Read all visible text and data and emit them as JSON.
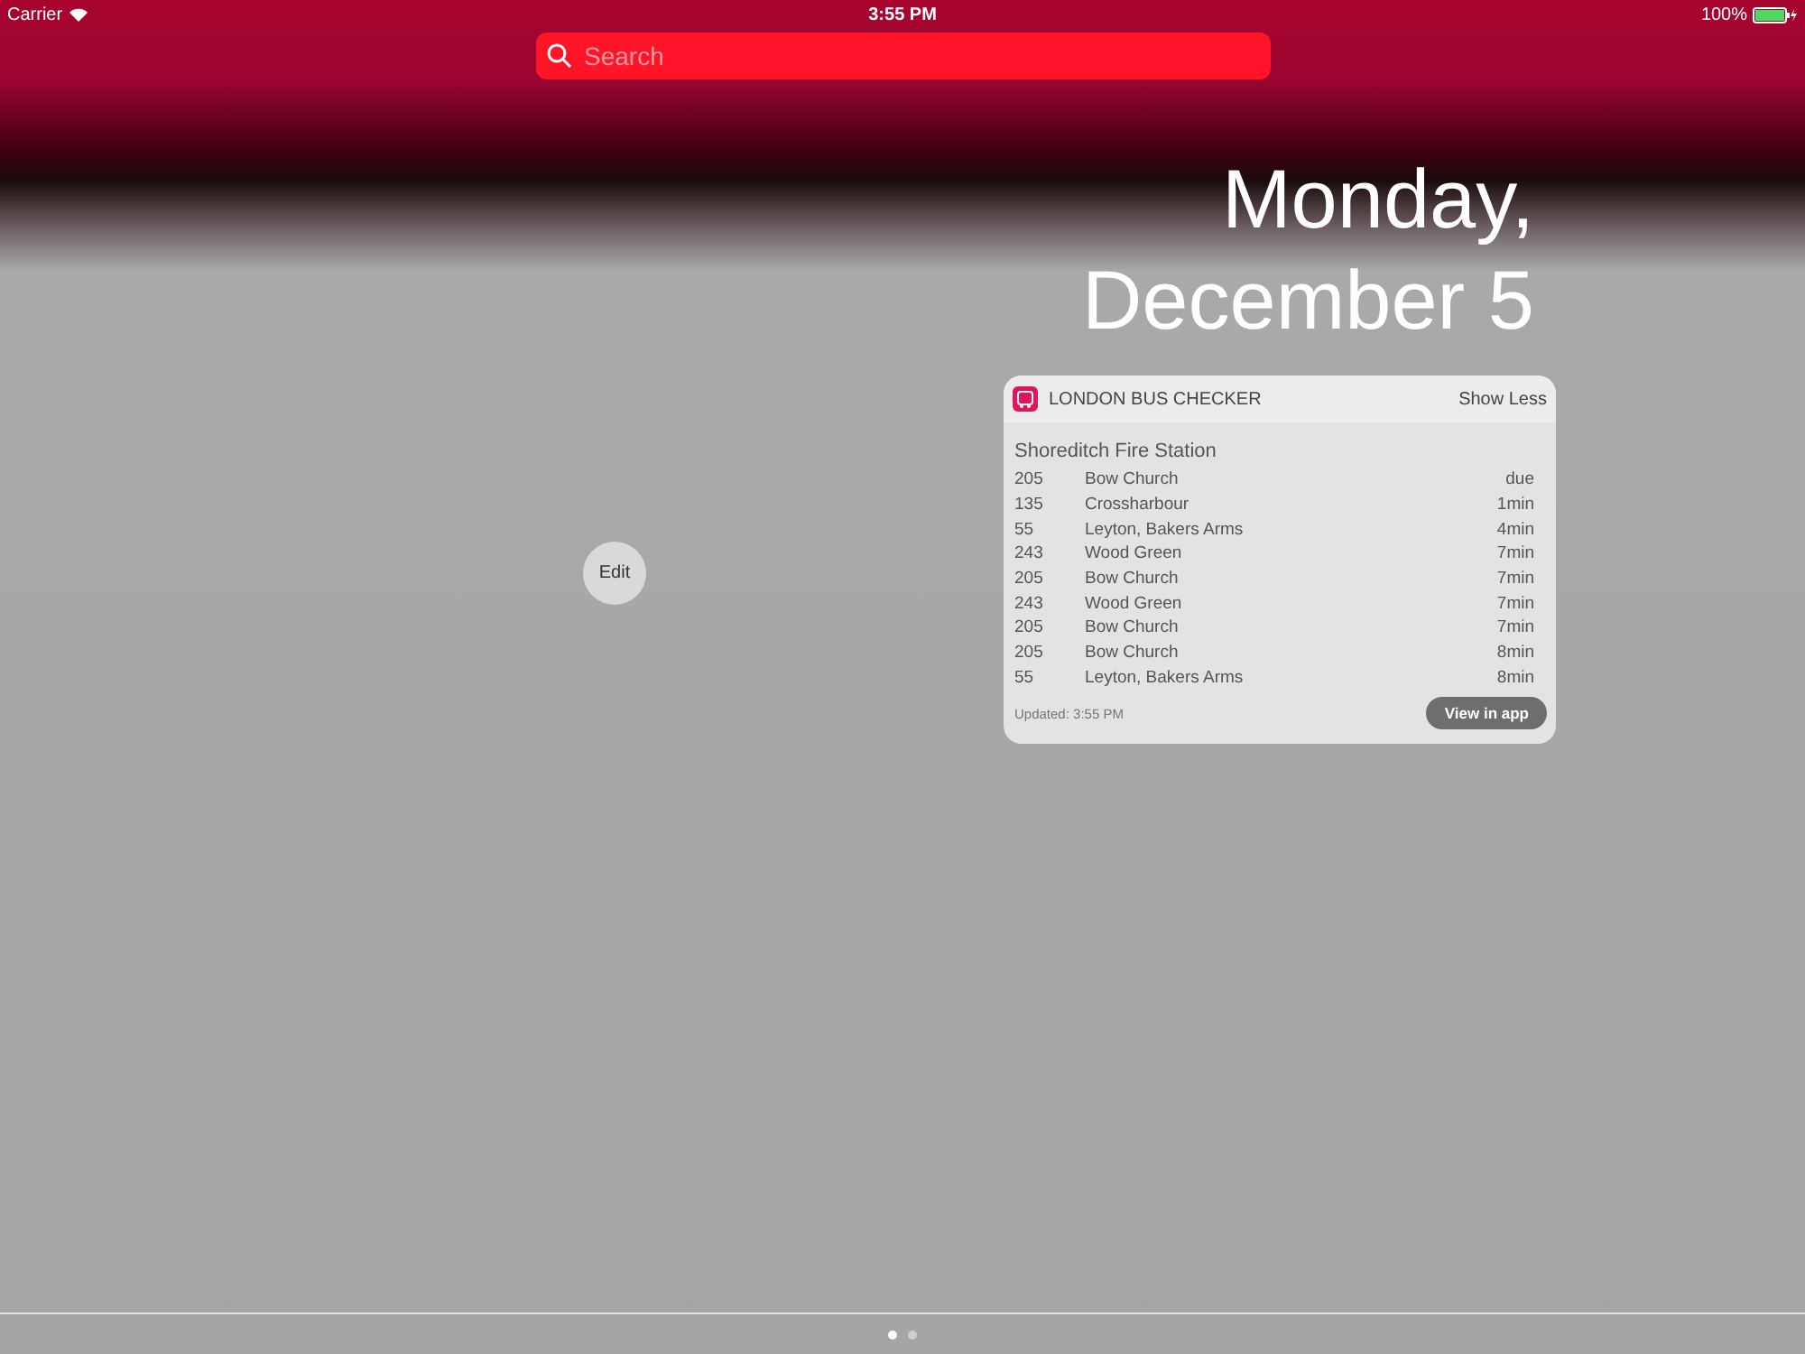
{
  "status_bar": {
    "carrier": "Carrier",
    "time": "3:55 PM",
    "battery": "100%"
  },
  "search": {
    "placeholder": "Search"
  },
  "date": {
    "weekday": "Monday,",
    "day": "December 5"
  },
  "edit_button": "Edit",
  "widget": {
    "app_name": "LONDON BUS CHECKER",
    "toggle": "Show Less",
    "stop": "Shoreditch Fire Station",
    "rows": [
      {
        "route": "205",
        "destination": "Bow Church",
        "eta": "due"
      },
      {
        "route": "135",
        "destination": "Crossharbour",
        "eta": "1min"
      },
      {
        "route": "55",
        "destination": "Leyton, Bakers Arms",
        "eta": "4min"
      },
      {
        "route": "243",
        "destination": "Wood Green",
        "eta": "7min"
      },
      {
        "route": "205",
        "destination": "Bow Church",
        "eta": "7min"
      },
      {
        "route": "243",
        "destination": "Wood Green",
        "eta": "7min"
      },
      {
        "route": "205",
        "destination": "Bow Church",
        "eta": "7min"
      },
      {
        "route": "205",
        "destination": "Bow Church",
        "eta": "8min"
      },
      {
        "route": "55",
        "destination": "Leyton, Bakers Arms",
        "eta": "8min"
      }
    ],
    "updated": "Updated: 3:55 PM",
    "action": "View in app"
  },
  "pages": [
    {
      "selected": true
    },
    {
      "selected": false
    }
  ]
}
